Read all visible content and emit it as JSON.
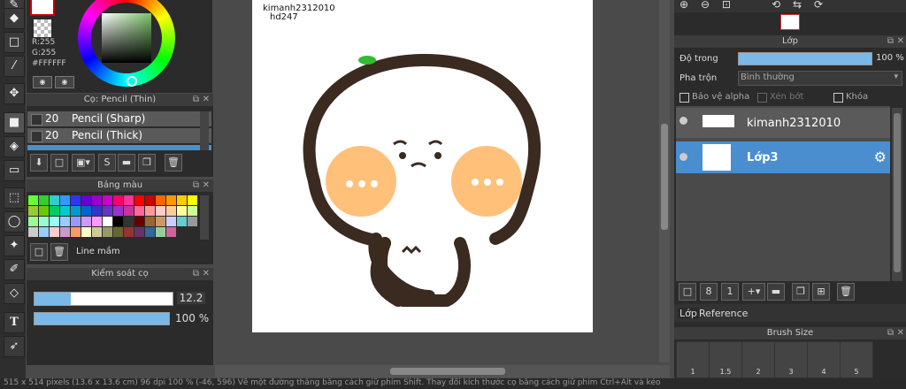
{
  "color": {
    "r": "R:255",
    "g": "G:255",
    "hex": "#FFFFFF"
  },
  "brush_panel": {
    "title": "Cọ: Pencil (Thin)",
    "items": [
      {
        "size": "20",
        "name": "Pencil (Sharp)"
      },
      {
        "size": "20",
        "name": "Pencil (Thick)"
      },
      {
        "size": "",
        "name": ""
      }
    ]
  },
  "palette_panel": {
    "title": "Bảng màu",
    "name": "Line mầm",
    "colors": [
      "#66ff33",
      "#33cc33",
      "#33cccc",
      "#3399ff",
      "#3333ff",
      "#6600cc",
      "#9900cc",
      "#cc00cc",
      "#ff0066",
      "#ff3399",
      "#ff0000",
      "#cc0000",
      "#ff6600",
      "#ff9900",
      "#ffcc00",
      "#ffff00",
      "#99cc33",
      "#66cc00",
      "#00cc66",
      "#00cccc",
      "#0099cc",
      "#0066cc",
      "#3333cc",
      "#6633cc",
      "#9933cc",
      "#cc3399",
      "#ff6699",
      "#ff9999",
      "#ffcccc",
      "#ffcc99",
      "#ffff99",
      "#ccff99",
      "#99ff99",
      "#99ffcc",
      "#99ffff",
      "#99ccff",
      "#9999ff",
      "#cc99ff",
      "#ff99ff",
      "#ffffff",
      "#000000",
      "#333333",
      "#660000",
      "#996633",
      "#cc9966",
      "#ccccff",
      "#66cccc",
      "#999999",
      "#cccccc",
      "#99ccff",
      "#ffcccc",
      "#cc99cc",
      "#ff9966",
      "#ffffcc",
      "#cccc99",
      "#999966",
      "#666633",
      "#993333",
      "#663366",
      "#336699",
      "#99cc99",
      "#cc6699"
    ]
  },
  "brush_control": {
    "title": "Kiểm soát cọ",
    "size": "12.2",
    "opacity": "100 %",
    "size_fill": 0.26,
    "opacity_fill": 1.0
  },
  "canvas": {
    "watermark1": "kimanh2312010",
    "watermark2": "hd247"
  },
  "layer_panel": {
    "title": "Lớp",
    "opacity_label": "Độ trong",
    "opacity_value": "100 %",
    "opacity_fill": 1.0,
    "blend_label": "Pha trộn",
    "blend_value": "Bình thường",
    "protect_alpha": "Bảo vệ alpha",
    "clip": "Xén bớt",
    "lock": "Khóa",
    "layers": [
      {
        "name": "kimanh2312010",
        "selected": false
      },
      {
        "name": "Lớp3",
        "selected": true
      }
    ],
    "tabs": [
      "Lớp",
      "Reference"
    ]
  },
  "brush_size_panel": {
    "title": "Brush Size",
    "sizes": [
      "1",
      "1.5",
      "2",
      "3",
      "4",
      "5"
    ]
  },
  "status": {
    "text": "515 x 514 pixels (13.6 x 13.6 cm) 96 dpi 100 % (-46, 596) Vẽ một đường thẳng bằng cách giữ phím Shift. Thay đổi kích thước cọ bằng cách giữ phím Ctrl+Alt và kéo"
  }
}
